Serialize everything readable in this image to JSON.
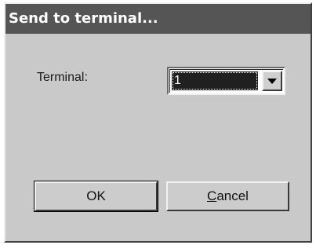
{
  "dialog": {
    "title": "Send to terminal...",
    "terminal_label": "Terminal:",
    "terminal_select": {
      "value": "1",
      "dropdown_icon": "chevron-down-icon"
    },
    "ok_label": "OK",
    "cancel_label": "Cancel"
  },
  "colors": {
    "titlebar": "#555555",
    "dialog_bg": "#c9c9c9",
    "selection_bg": "#202020"
  }
}
